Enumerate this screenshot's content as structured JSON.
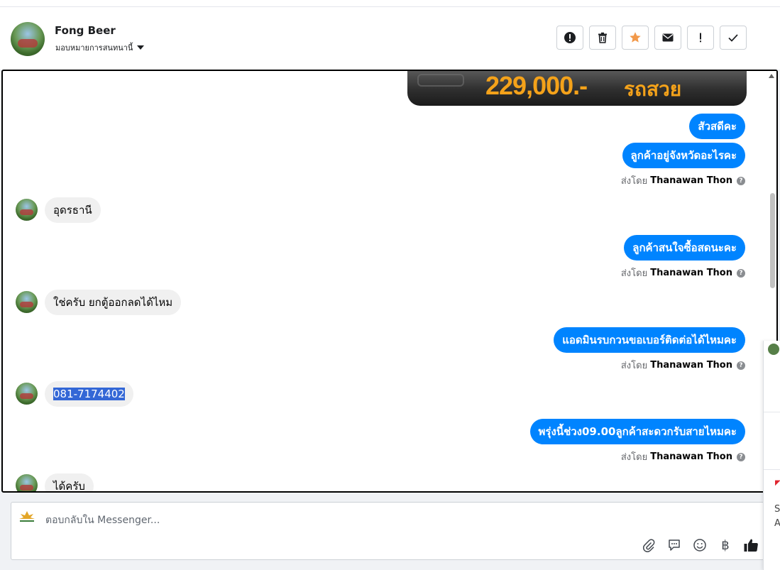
{
  "header": {
    "name": "Fong Beer",
    "assign_label": "มอบหมายการสนทนานี้",
    "buttons": [
      {
        "name": "spam",
        "icon": "exclamation-circle-icon"
      },
      {
        "name": "delete",
        "icon": "trash-icon"
      },
      {
        "name": "star",
        "icon": "star-icon",
        "color": "#f2994a"
      },
      {
        "name": "mark-unread",
        "icon": "envelope-icon"
      },
      {
        "name": "follow-up",
        "icon": "exclamation-icon"
      },
      {
        "name": "done",
        "icon": "check-icon"
      }
    ]
  },
  "banner": {
    "price": "229,000.-",
    "tag": "รถสวย"
  },
  "messages": [
    {
      "dir": "out",
      "text": "สัวสดีคะ"
    },
    {
      "dir": "out",
      "text": "ลูกค้าอยู่จังหวัดอะไรคะ",
      "sent_prefix": "ส่งโดย",
      "sent_by": "Thanawan Thon"
    },
    {
      "dir": "in",
      "text": "อุดรธานี"
    },
    {
      "dir": "out",
      "text": "ลูกค้าสนใจซื้อสดนะคะ",
      "sent_prefix": "ส่งโดย",
      "sent_by": "Thanawan Thon"
    },
    {
      "dir": "in",
      "text": "ใช่ครับ   ยกตู้ออกลดได้ไหม"
    },
    {
      "dir": "out",
      "text": "แอดมินรบกวนขอเบอร์ติดต่อได้ไหมคะ",
      "sent_prefix": "ส่งโดย",
      "sent_by": "Thanawan Thon"
    },
    {
      "dir": "in",
      "text": "081-7174402",
      "selected": true
    },
    {
      "dir": "out",
      "text": "พรุ่งนี้ช่วง09.00ลูกค้าสะดวกรับสายไหมคะ",
      "sent_prefix": "ส่งโดย",
      "sent_by": "Thanawan Thon"
    },
    {
      "dir": "in",
      "text": "ได้ครับ"
    }
  ],
  "composer": {
    "placeholder": "ตอบกลับใน Messenger...",
    "tools": [
      "paperclip-icon",
      "speech-bubble-icon",
      "smiley-icon",
      "baht-icon",
      "thumbs-up-icon"
    ],
    "baht_symbol": "฿"
  },
  "side_panel": {
    "text1": "S",
    "text2": "A"
  },
  "colors": {
    "outgoing_bubble": "#0084ff",
    "incoming_bubble": "#f0f0f0",
    "selection": "#3367d6",
    "banner_text": "#f4a21a"
  }
}
